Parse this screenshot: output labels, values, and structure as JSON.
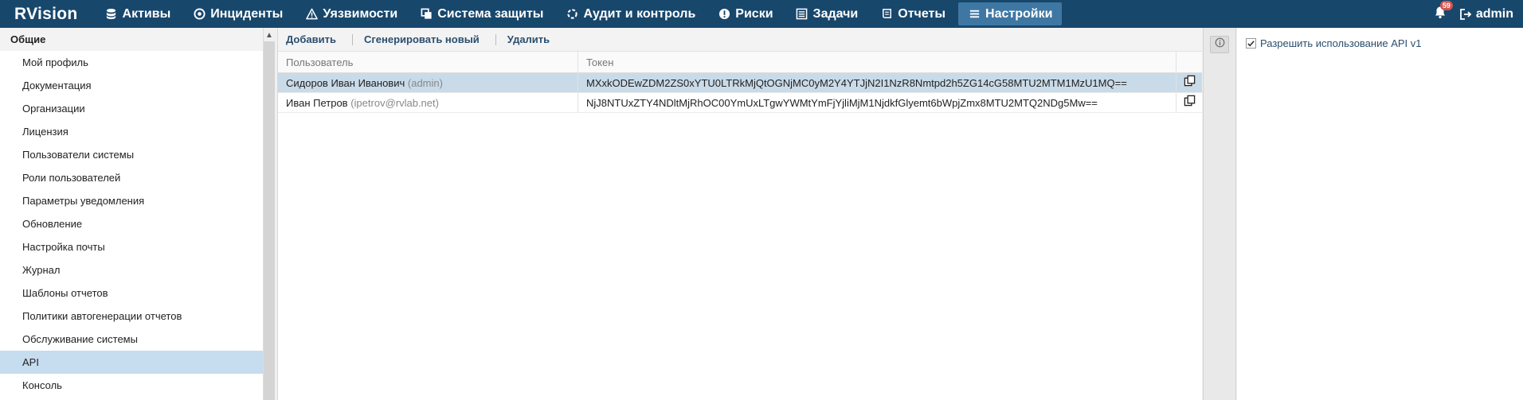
{
  "app": {
    "logo": "RVision"
  },
  "nav": {
    "items": [
      {
        "label": "Активы",
        "icon": "database-icon"
      },
      {
        "label": "Инциденты",
        "icon": "target-icon"
      },
      {
        "label": "Уязвимости",
        "icon": "warning-icon"
      },
      {
        "label": "Система защиты",
        "icon": "windows-icon"
      },
      {
        "label": "Аудит и контроль",
        "icon": "cycle-icon"
      },
      {
        "label": "Риски",
        "icon": "alert-circle-icon"
      },
      {
        "label": "Задачи",
        "icon": "tasks-icon"
      },
      {
        "label": "Отчеты",
        "icon": "report-icon"
      },
      {
        "label": "Настройки",
        "icon": "menu-icon",
        "active": true
      }
    ]
  },
  "notifications": {
    "count": "59"
  },
  "user": {
    "name": "admin"
  },
  "sidebar": {
    "header": "Общие",
    "items": [
      {
        "label": "Мой профиль"
      },
      {
        "label": "Документация"
      },
      {
        "label": "Организации"
      },
      {
        "label": "Лицензия"
      },
      {
        "label": "Пользователи системы"
      },
      {
        "label": "Роли пользователей"
      },
      {
        "label": "Параметры уведомления"
      },
      {
        "label": "Обновление"
      },
      {
        "label": "Настройка почты"
      },
      {
        "label": "Журнал"
      },
      {
        "label": "Шаблоны отчетов"
      },
      {
        "label": "Политики автогенерации отчетов"
      },
      {
        "label": "Обслуживание системы"
      },
      {
        "label": "API",
        "active": true
      },
      {
        "label": "Консоль"
      }
    ]
  },
  "toolbar": {
    "add_label": "Добавить",
    "generate_label": "Сгенерировать новый",
    "delete_label": "Удалить"
  },
  "table": {
    "columns": [
      "Пользователь",
      "Токен"
    ],
    "rows": [
      {
        "user": "Сидоров Иван Иванович",
        "login": "(admin)",
        "token": "MXxkODEwZDM2ZS0xYTU0LTRkMjQtOGNjMC0yM2Y4YTJjN2I1NzR8Nmtpd2h5ZG14cG58MTU2MTM1MzU1MQ==",
        "selected": true
      },
      {
        "user": "Иван Петров",
        "login": "(ipetrov@rvlab.net)",
        "token": "NjJ8NTUxZTY4NDltMjRhOC00YmUxLTgwYWMtYmFjYjliMjM1NjdkfGlyemt6bWpjZmx8MTU2MTQ2NDg5Mw==",
        "selected": false
      }
    ]
  },
  "settings": {
    "api_v1_label": "Разрешить использование API v1",
    "api_v1_checked": true
  },
  "colors": {
    "topbar": "#18476c",
    "nav_active": "#3f77a3",
    "sidebar_active": "#c6dcef",
    "row_selected": "#c9dbe8",
    "badge": "#d9534f"
  }
}
